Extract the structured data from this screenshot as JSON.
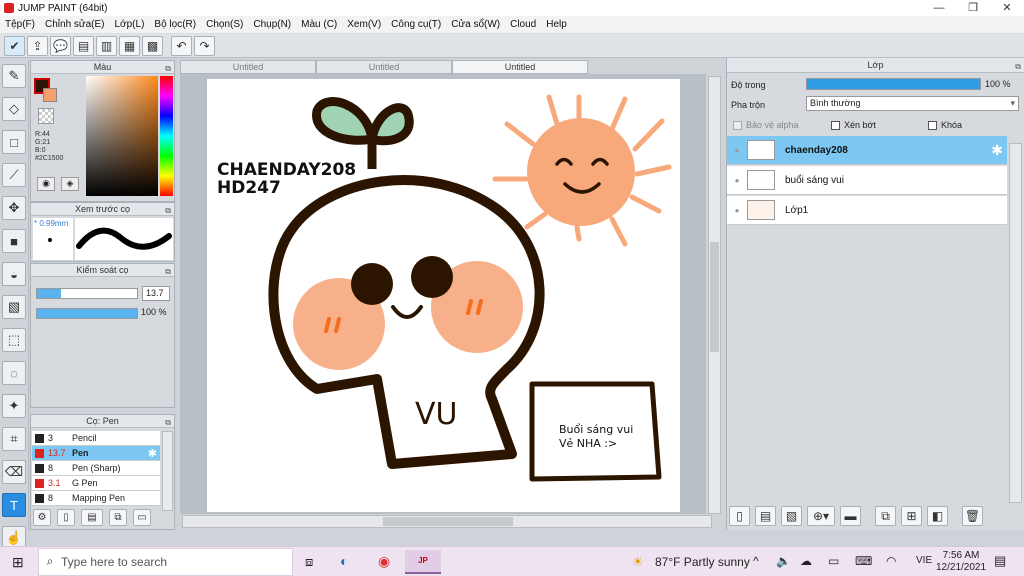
{
  "window": {
    "title": "JUMP PAINT (64bit)",
    "min": "—",
    "max": "❐",
    "close": "✕"
  },
  "menu": [
    "Tệp(F)",
    "Chỉnh sửa(E)",
    "Lớp(L)",
    "Bộ lọc(R)",
    "Chọn(S)",
    "Chụp(N)",
    "Màu (C)",
    "Xem(V)",
    "Công cụ(T)",
    "Cửa sổ(W)",
    "Cloud",
    "Help"
  ],
  "color_panel": {
    "title": "Màu",
    "r": "R:44",
    "g": "G:21",
    "b": "B:0",
    "hex": "#2C1500",
    "main_color": "#2c1500",
    "sub_color": "#f7a06e"
  },
  "brush_preview": {
    "title": "Xem trước cọ",
    "size": "* 0.99mm"
  },
  "brush_control": {
    "title": "Kiểm soát cọ",
    "size_value": "13.7",
    "opacity_value": "100 %",
    "size_fraction": 0.24,
    "opacity_fraction": 1.0
  },
  "brush_list": {
    "title": "Cọ: Pen",
    "items": [
      {
        "size": "3",
        "name": "Pencil",
        "red": false,
        "selected": false
      },
      {
        "size": "13.7",
        "name": "Pen",
        "red": true,
        "selected": true
      },
      {
        "size": "8",
        "name": "Pen (Sharp)",
        "red": false,
        "selected": false
      },
      {
        "size": "3.1",
        "name": "G Pen",
        "red": true,
        "selected": false
      },
      {
        "size": "8",
        "name": "Mapping Pen",
        "red": false,
        "selected": false
      }
    ]
  },
  "doc_tabs": [
    "Untitled",
    "Untitled",
    "Untitled"
  ],
  "canvas_text": {
    "line1": "CHAENDAY208",
    "line2": "HD247",
    "bubble1": "Buổi sáng vui",
    "bubble2": "Vẻ NHA :>",
    "vu": "VU"
  },
  "layers_panel": {
    "title": "Lớp",
    "opacity_label": "Độ trong",
    "opacity_value": "100 %",
    "opacity_fraction": 1.0,
    "blend_label": "Pha trộn",
    "blend_value": "Bình thường",
    "protect_alpha": "Bảo vệ alpha",
    "clip": "Xén bớt",
    "lock": "Khóa",
    "layers": [
      {
        "name": "chaenday208",
        "selected": true
      },
      {
        "name": "buổi sáng vui",
        "selected": false
      },
      {
        "name": "Lớp1",
        "selected": false
      }
    ]
  },
  "taskbar": {
    "search_placeholder": "Type here to search",
    "weather": "87°F  Partly sunny",
    "lang": "VIE",
    "time": "7:56 AM",
    "date": "12/21/2021"
  },
  "colors": {
    "accent": "#2b8de0",
    "sun": "#f7a97c",
    "outline": "#2c1500",
    "leaf": "#9fd3b4",
    "selected_layer": "#7cc8f2"
  }
}
